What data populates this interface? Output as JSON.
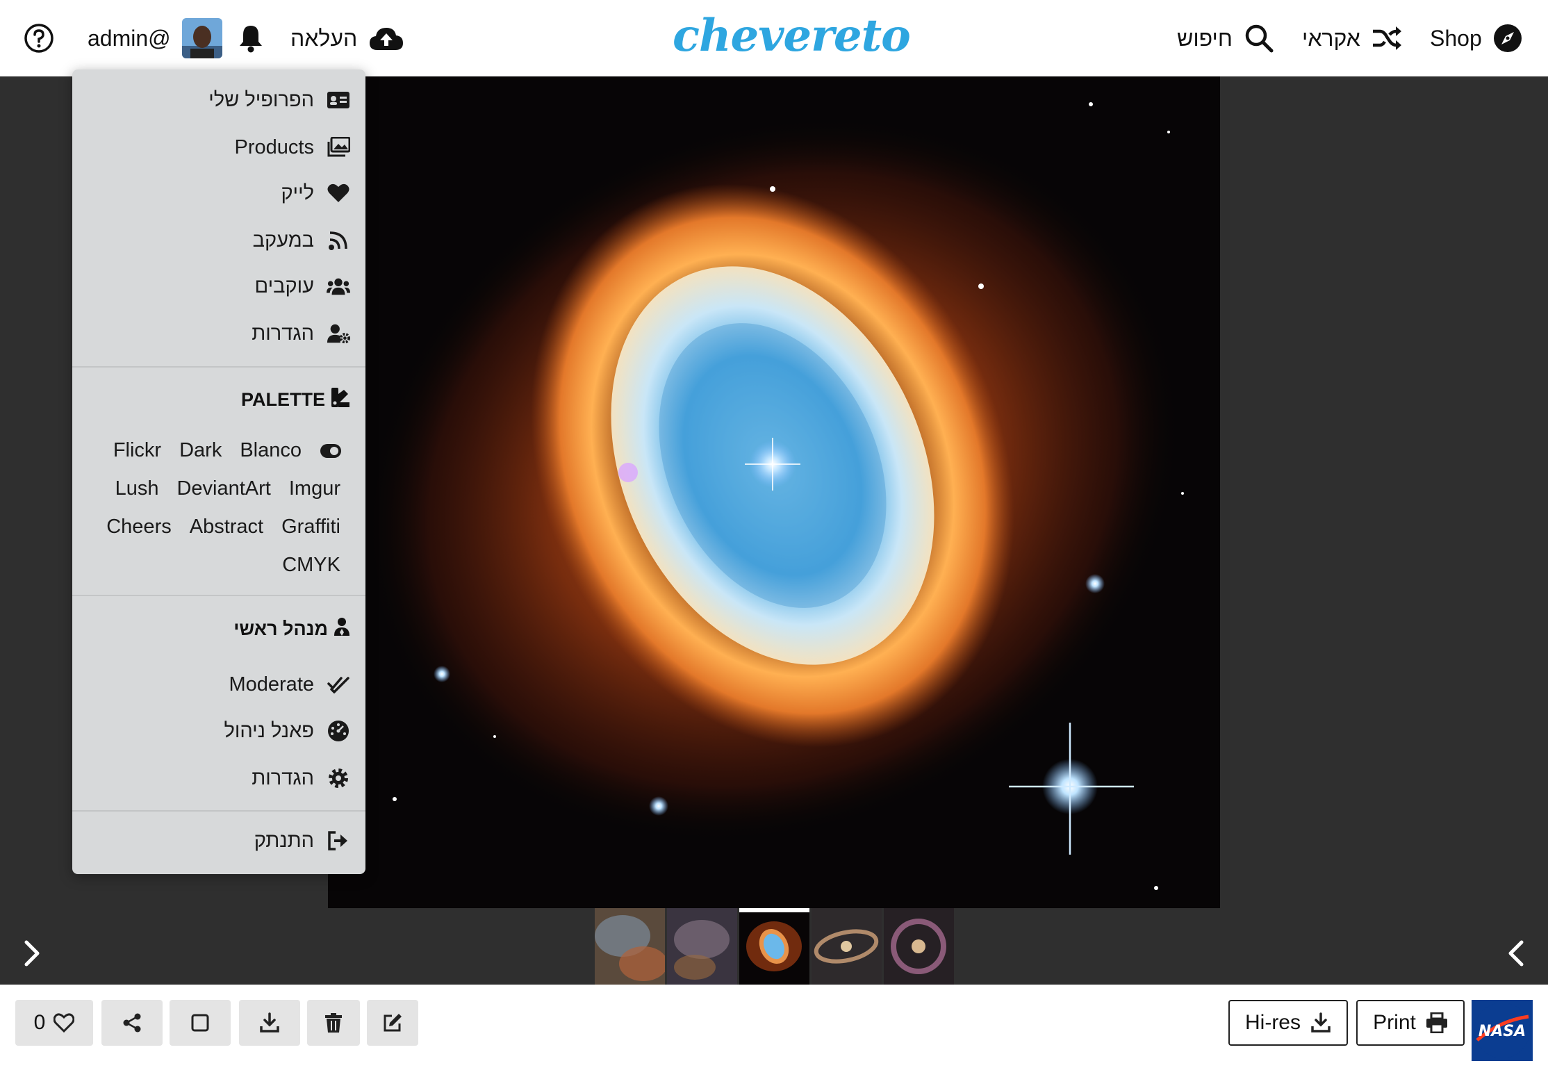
{
  "header": {
    "help_icon": "question-circle-icon",
    "username": "admin@",
    "notifications_icon": "bell-icon",
    "upload_label": "העלאה",
    "upload_icon": "cloud-upload-icon",
    "logo": "chevereto",
    "search_label": "חיפוש",
    "random_label": "אקראי",
    "shop_label": "Shop"
  },
  "user_menu": {
    "items": [
      {
        "label": "הפרופיל שלי",
        "icon": "id-card-icon"
      },
      {
        "label": "Products",
        "icon": "images-icon"
      },
      {
        "label": "לייק",
        "icon": "heart-icon"
      },
      {
        "label": "במעקב",
        "icon": "rss-icon"
      },
      {
        "label": "עוקבים",
        "icon": "users-icon"
      },
      {
        "label": "הגדרות",
        "icon": "user-gear-icon"
      }
    ],
    "palette": {
      "heading": "PALETTE",
      "rows": [
        [
          "Blanco",
          "Dark",
          "Flickr"
        ],
        [
          "Imgur",
          "DeviantArt",
          "Lush"
        ],
        [
          "Graffiti",
          "Abstract",
          "Cheers"
        ],
        [
          "CMYK"
        ]
      ]
    },
    "admin": {
      "heading": "מנהל ראשי",
      "items": [
        {
          "label": "Moderate",
          "icon": "check-double-icon"
        },
        {
          "label": "פאנל ניהול",
          "icon": "gauge-icon"
        },
        {
          "label": "הגדרות",
          "icon": "gear-icon"
        }
      ]
    },
    "logout_label": "התנתק"
  },
  "toolbar": {
    "like_count": "0",
    "hires_label": "Hi-res",
    "print_label": "Print"
  },
  "colors": {
    "accent": "#2ea6e0",
    "stage_bg": "#2f2f2f",
    "menu_bg": "#d7d9da"
  }
}
